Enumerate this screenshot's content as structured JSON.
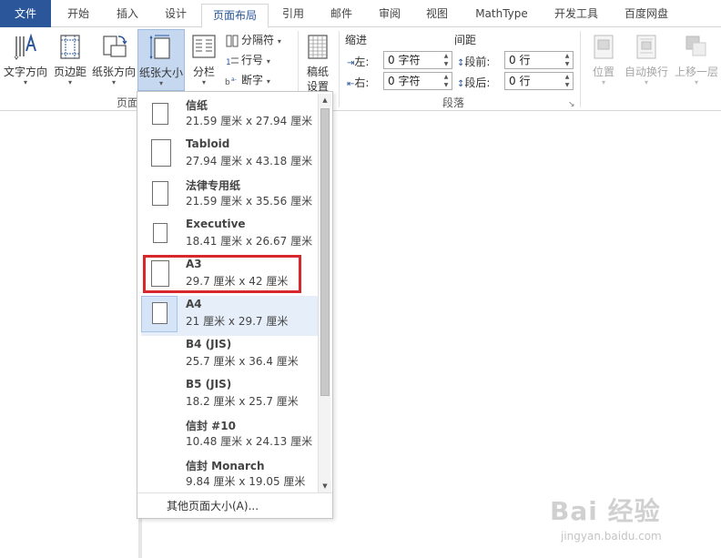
{
  "tabs": [
    "文件",
    "开始",
    "插入",
    "设计",
    "页面布局",
    "引用",
    "邮件",
    "审阅",
    "视图",
    "MathType",
    "开发工具",
    "百度网盘"
  ],
  "ribbon": {
    "text_direction": "文字方向",
    "margins": "页边距",
    "orientation": "纸张方向",
    "size": "纸张大小",
    "columns": "分栏",
    "breaks": "分隔符",
    "line_numbers": "行号",
    "hyphenation": "断字",
    "draft_paper": "稿纸\n设置",
    "draft_paper_line1": "稿纸",
    "draft_paper_line2": "设置",
    "group_page_setup": "页面",
    "indent": {
      "title": "缩进",
      "left_label": "左:",
      "left_value": "0 字符",
      "right_label": "右:",
      "right_value": "0 字符"
    },
    "spacing": {
      "title": "间距",
      "before_label": "段前:",
      "before_value": "0 行",
      "after_label": "段后:",
      "after_value": "0 行"
    },
    "group_paragraph": "段落",
    "position": "位置",
    "wrap_text": "自动换行",
    "bring_forward": "上移一层",
    "arrow": "▾"
  },
  "paper_sizes": [
    {
      "name": "信纸",
      "dim": "21.59 厘米 x 27.94 厘米"
    },
    {
      "name": "Tabloid",
      "dim": "27.94 厘米 x 43.18 厘米"
    },
    {
      "name": "法律专用纸",
      "dim": "21.59 厘米 x 35.56 厘米"
    },
    {
      "name": "Executive",
      "dim": "18.41 厘米 x 26.67 厘米"
    },
    {
      "name": "A3",
      "dim": "29.7 厘米 x 42 厘米"
    },
    {
      "name": "A4",
      "dim": "21 厘米 x 29.7 厘米"
    },
    {
      "name": "B4 (JIS)",
      "dim": "25.7 厘米 x 36.4 厘米"
    },
    {
      "name": "B5 (JIS)",
      "dim": "18.2 厘米 x 25.7 厘米"
    },
    {
      "name": "信封 #10",
      "dim": "10.48 厘米 x 24.13 厘米"
    },
    {
      "name": "信封 Monarch",
      "dim": "9.84 厘米 x 19.05 厘米"
    }
  ],
  "more_sizes": "其他页面大小(A)...",
  "watermark": {
    "main": "Bai 经验",
    "sub": "jingyan.baidu.com"
  },
  "colors": {
    "file_tab": "#2b579a",
    "highlight": "#d9272e",
    "selected": "#e5eef9"
  }
}
